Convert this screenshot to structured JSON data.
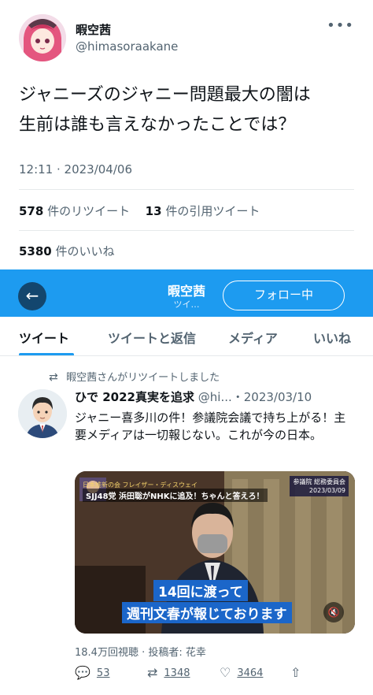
{
  "tweet": {
    "author_name": "暇空茜",
    "author_handle": "@himasoraakane",
    "text_line1": "ジャニーズのジャニー問題最大の闇は",
    "text_line2": "生前は誰も言えなかったことでは？",
    "timestamp": "12:11 · 2023/04/06",
    "retweets": {
      "count": "578",
      "label": "件のリツイート"
    },
    "quotes": {
      "count": "13",
      "label": "件の引用ツイート"
    },
    "likes": {
      "count": "5380",
      "label": "件のいいね"
    },
    "more_icon": "more-horizontal-icon"
  },
  "screenshot": {
    "profile_name": "暇空茜",
    "profile_sub": "ツイ…",
    "back_icon": "arrow-left-icon",
    "follow_label": "フォロー中",
    "tabs": [
      {
        "label": "ツイート",
        "active": true
      },
      {
        "label": "ツイートと返信",
        "active": false
      },
      {
        "label": "メディア",
        "active": false
      },
      {
        "label": "いいね",
        "active": false
      }
    ],
    "retweet_notice": "暇空茜さんがリツイートしました",
    "inner_tweet": {
      "name": "ひで 2022真実を追求",
      "meta": "@hi...・2023/03/10",
      "text": "ジャニー喜多川の件！参議院会議で持ち上がる！主要メディアは一切報じない。これが今の日本。",
      "video": {
        "top_small": "日本維新の会 フレイザー・ディスウェイ",
        "headline": "SJJ48党 浜田聡がNHKに追及！ちゃんと答えろ！",
        "chyron_line1": "参議院 総務委員会",
        "chyron_line2": "2023/03/09",
        "subtitle_line1": "14回に渡って",
        "subtitle_line2": "週刊文春が報じております"
      },
      "views": "18.4万回視聴 · 投稿者: 花幸",
      "replies": "53",
      "retweets": "1348",
      "likes": "3464"
    }
  },
  "colors": {
    "accent": "#1d9bf0",
    "text": "#0f1419",
    "muted": "#536471"
  }
}
